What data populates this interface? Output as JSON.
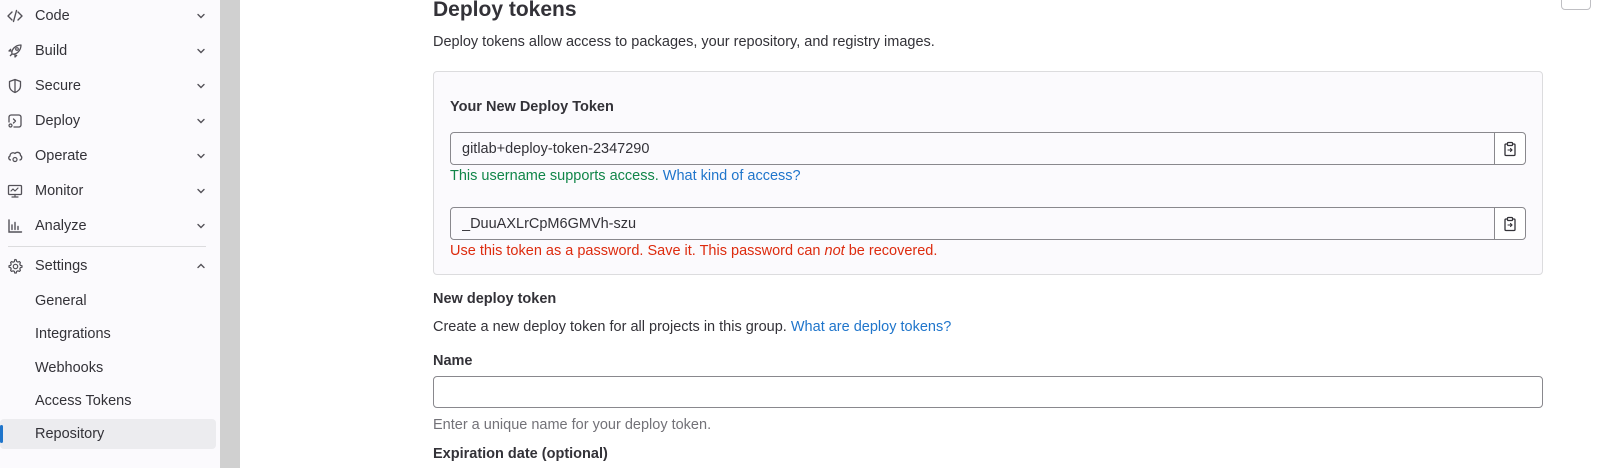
{
  "sidebar": {
    "items": [
      {
        "label": "Code",
        "icon": "code-icon"
      },
      {
        "label": "Build",
        "icon": "rocket-icon"
      },
      {
        "label": "Secure",
        "icon": "shield-icon"
      },
      {
        "label": "Deploy",
        "icon": "deployments-icon"
      },
      {
        "label": "Operate",
        "icon": "cloud-gear-icon"
      },
      {
        "label": "Monitor",
        "icon": "monitor-icon"
      },
      {
        "label": "Analyze",
        "icon": "chart-icon"
      },
      {
        "label": "Settings",
        "icon": "gear-icon",
        "expanded": true
      }
    ],
    "settings_subitems": [
      {
        "label": "General"
      },
      {
        "label": "Integrations"
      },
      {
        "label": "Webhooks"
      },
      {
        "label": "Access Tokens"
      },
      {
        "label": "Repository",
        "active": true
      }
    ]
  },
  "main": {
    "title": "Deploy tokens",
    "description": "Deploy tokens allow access to packages, your repository, and registry images.",
    "new_token_panel": {
      "heading": "Your New Deploy Token",
      "username_value": "gitlab+deploy-token-2347290",
      "username_help": "This username supports access.",
      "username_help_link": "What kind of access?",
      "token_value": "_DuuAXLrCpM6GMVh-szu",
      "token_warning_before": "Use this token as a password. Save it. This password can",
      "token_warning_emph": "not",
      "token_warning_after": "be recovered."
    },
    "new_token_form": {
      "title": "New deploy token",
      "description": "Create a new deploy token for all projects in this group.",
      "description_link": "What are deploy tokens?",
      "name_label": "Name",
      "name_value": "",
      "name_hint": "Enter a unique name for your deploy token.",
      "expiration_label": "Expiration date (optional)"
    }
  },
  "colors": {
    "link": "#1f75cb",
    "success": "#108548",
    "danger": "#dd2b0e",
    "active_indicator": "#1f75cb"
  }
}
